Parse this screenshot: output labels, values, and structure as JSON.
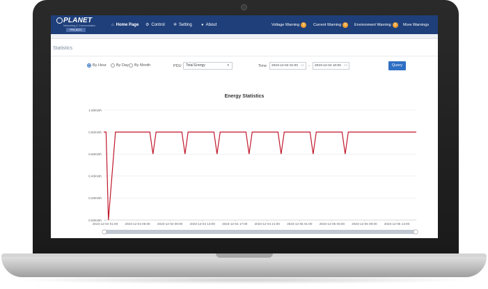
{
  "brand": {
    "name": "PLANET",
    "tagline": "Networking & Communication",
    "model": "IPM-8221"
  },
  "nav": {
    "home": "Home Page",
    "control": "Control",
    "setting": "Setting",
    "about": "About"
  },
  "warnings": {
    "voltage": {
      "label": "Voltage Warning",
      "count": "0"
    },
    "current": {
      "label": "Current Warning",
      "count": "0"
    },
    "environment": {
      "label": "Environment Warning",
      "count": "0"
    },
    "more": "More Warnings"
  },
  "page_title": "Statistics",
  "filters": {
    "by_hour": "By Hour",
    "by_day": "By Day",
    "by_month": "By Month",
    "selected": "By Hour",
    "pdu_label": "PDU",
    "pdu_value": "Total Energy",
    "time_label": "Time",
    "time_from": "2023-12-04 01:00",
    "time_to": "2023-12-04 10:00",
    "query": "Query"
  },
  "colors": {
    "nav_bg": "#1f3f7a",
    "accent": "#2f6fc4",
    "badge": "#f0a030",
    "line": "#c0162a"
  },
  "chart_data": {
    "type": "line",
    "title": "Energy Statistics",
    "ylim": [
      0,
      1
    ],
    "y_ticks": [
      "0.00KWh",
      "0.20KWh",
      "0.40KWh",
      "0.60KWh",
      "0.80KWh",
      "1.00KWh"
    ],
    "y_tick_values": [
      0,
      0.2,
      0.4,
      0.6,
      0.8,
      1.0
    ],
    "x_ticks": [
      "2023-12-04 01:00",
      "2023-12-04 05:00",
      "2023-12-04 09:00",
      "2023-12-04 13:00",
      "2023-12-04 17:00",
      "2023-12-04 21:00",
      "2023-12-05 01:00",
      "2023-12-05 05:00",
      "2023-12-05 09:00",
      "2023-12-05 13:00"
    ],
    "x_range_hours": [
      0,
      40
    ],
    "series": [
      {
        "x": [
          0,
          0.3,
          0.6,
          1.5,
          5.9,
          6.3,
          6.7,
          10.0,
          10.4,
          10.8,
          14.1,
          14.5,
          14.9,
          18.2,
          18.6,
          19.0,
          22.3,
          22.7,
          23.1,
          26.4,
          26.8,
          27.2,
          30.5,
          30.9,
          31.3,
          40.0
        ],
        "y": [
          0.8,
          0.8,
          0.0,
          0.8,
          0.8,
          0.6,
          0.8,
          0.8,
          0.6,
          0.8,
          0.8,
          0.6,
          0.8,
          0.8,
          0.6,
          0.8,
          0.8,
          0.6,
          0.8,
          0.8,
          0.6,
          0.8,
          0.8,
          0.6,
          0.8,
          0.8
        ]
      }
    ]
  }
}
